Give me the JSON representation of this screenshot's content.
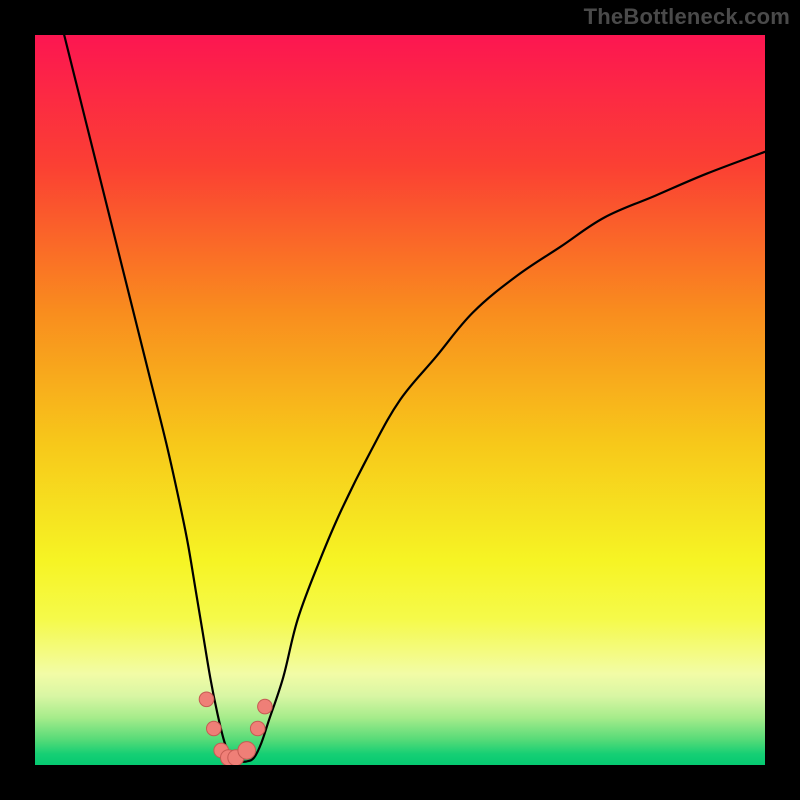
{
  "attribution": "TheBottleneck.com",
  "colors": {
    "frame": "#000000",
    "text": "#4a4a4a",
    "curve": "#000000",
    "marker_fill": "#ef7f77",
    "marker_stroke": "#c65a53",
    "gradient_stops": [
      {
        "offset": 0.0,
        "color": "#fc1651"
      },
      {
        "offset": 0.18,
        "color": "#fb4033"
      },
      {
        "offset": 0.38,
        "color": "#f98d1e"
      },
      {
        "offset": 0.56,
        "color": "#f7c81a"
      },
      {
        "offset": 0.72,
        "color": "#f6f424"
      },
      {
        "offset": 0.8,
        "color": "#f5fa4a"
      },
      {
        "offset": 0.845,
        "color": "#f4fb80"
      },
      {
        "offset": 0.875,
        "color": "#f2fca6"
      },
      {
        "offset": 0.905,
        "color": "#d9f6a4"
      },
      {
        "offset": 0.935,
        "color": "#a6ec8b"
      },
      {
        "offset": 0.965,
        "color": "#57db78"
      },
      {
        "offset": 0.985,
        "color": "#16cf74"
      },
      {
        "offset": 1.0,
        "color": "#05c971"
      }
    ]
  },
  "chart_data": {
    "type": "line",
    "title": "",
    "xlabel": "",
    "ylabel": "",
    "xlim": [
      0,
      100
    ],
    "ylim": [
      0,
      100
    ],
    "series": [
      {
        "name": "bottleneck-curve",
        "x": [
          4,
          6,
          8,
          10,
          12,
          14,
          16,
          18,
          20,
          21,
          22,
          23,
          24,
          25,
          26,
          27,
          28,
          29,
          30,
          31,
          32,
          34,
          36,
          39,
          42,
          46,
          50,
          55,
          60,
          66,
          72,
          78,
          85,
          92,
          100
        ],
        "y": [
          100,
          92,
          84,
          76,
          68,
          60,
          52,
          44,
          35,
          30,
          24,
          18,
          12,
          7,
          3,
          1,
          0.5,
          0.5,
          1,
          3,
          6,
          12,
          20,
          28,
          35,
          43,
          50,
          56,
          62,
          67,
          71,
          75,
          78,
          81,
          84
        ]
      }
    ],
    "markers": {
      "name": "trough-markers",
      "style": "filled-circle",
      "x": [
        23.5,
        24.5,
        25.5,
        26.5,
        27.5,
        29,
        30.5,
        31.5
      ],
      "y": [
        9,
        5,
        2,
        1,
        1,
        2,
        5,
        8
      ],
      "r": [
        1.0,
        1.0,
        1.0,
        1.1,
        1.1,
        1.2,
        1.0,
        1.0
      ]
    }
  }
}
